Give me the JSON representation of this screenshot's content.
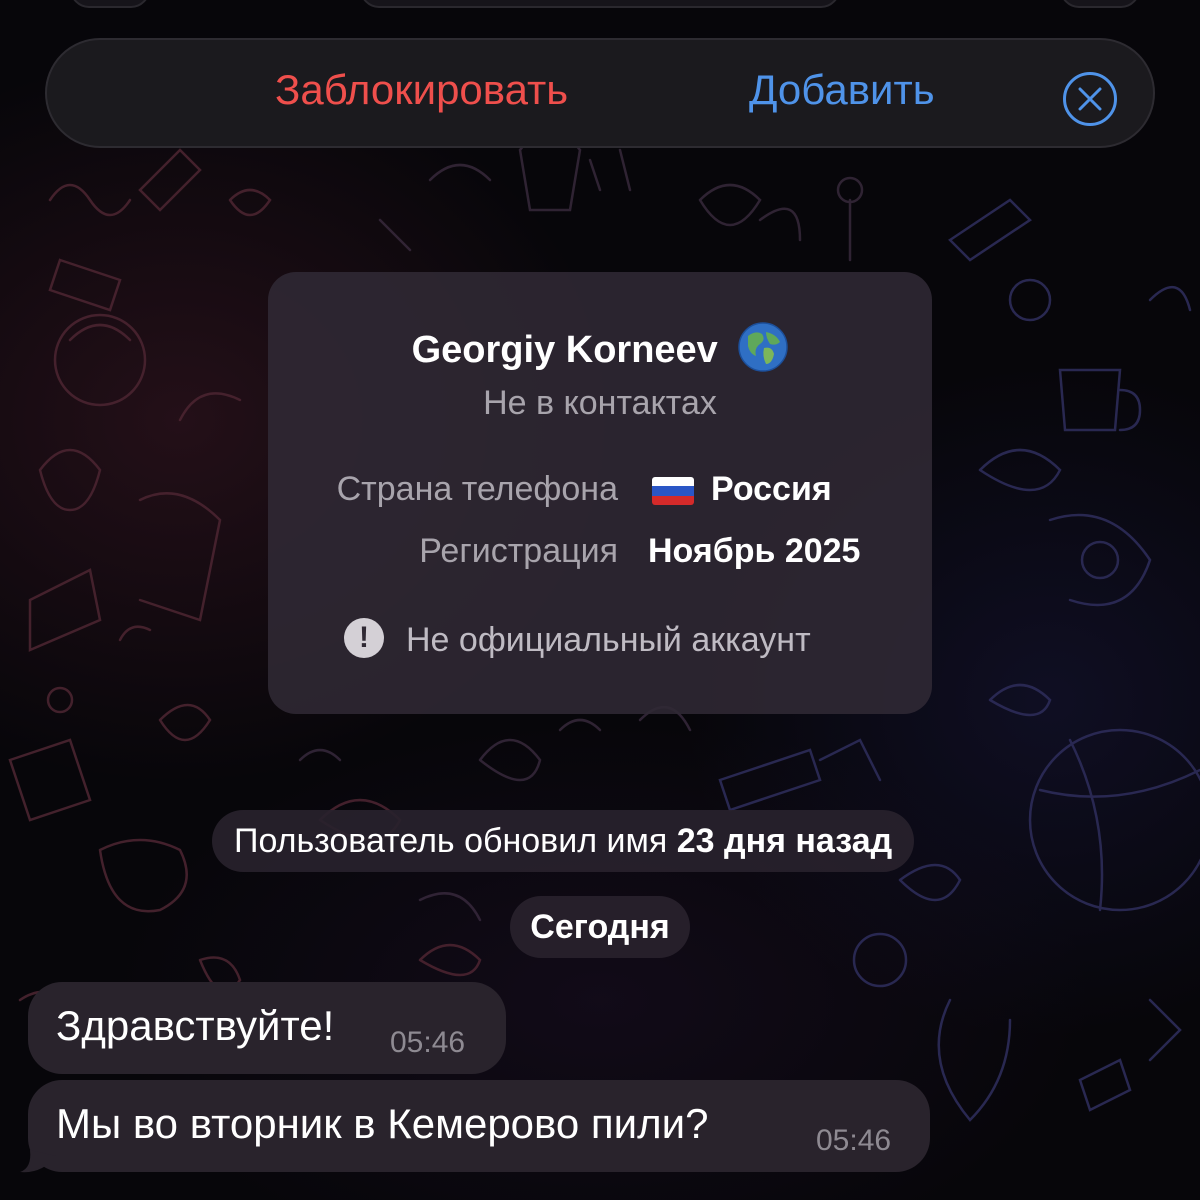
{
  "action_bar": {
    "block_label": "Заблокировать",
    "add_label": "Добавить",
    "close_icon": "close-circle-icon"
  },
  "info_card": {
    "name": "Georgiy Korneev",
    "name_icon": "globe-emoji-icon",
    "status": "Не в контактах",
    "phone_country_label": "Страна телефона",
    "phone_country_value": "Россия",
    "phone_country_icon": "russia-flag-icon",
    "registration_label": "Регистрация",
    "registration_value": "Ноябрь 2025",
    "warning_icon": "exclamation-circle-icon",
    "warning_text": "Не официальный аккаунт"
  },
  "service": {
    "name_update_prefix": "Пользователь обновил имя ",
    "name_update_time": "23 дня назад",
    "date_label": "Сегодня"
  },
  "messages": [
    {
      "text": "Здравствуйте!",
      "time": "05:46"
    },
    {
      "text": "Мы во вторник в Кемерово пили?",
      "time": "05:46"
    }
  ],
  "colors": {
    "block": "#ef4f4c",
    "accent": "#4f93e9",
    "card_bg": "#302934",
    "bubble_bg": "#29232c"
  }
}
